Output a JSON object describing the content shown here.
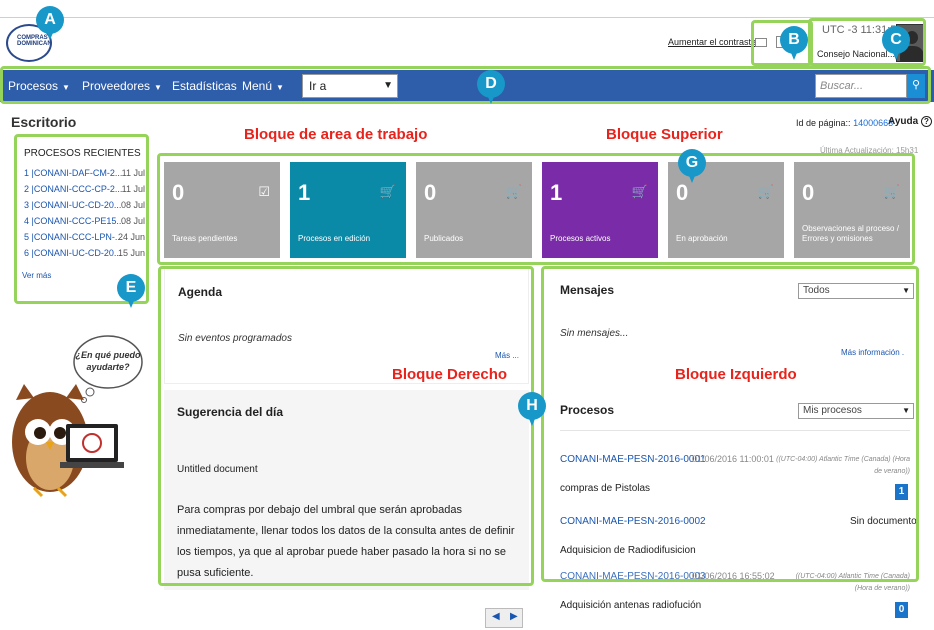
{
  "header": {
    "logo_text": "COMPRAS DOMINICANAS",
    "contrast_link": "Aumentar el contraste",
    "utc": "UTC -3 11:31:5",
    "user": "Consejo Nacional..."
  },
  "nav": {
    "items": [
      "Procesos",
      "Proveedores",
      "Estadísticas",
      "Menú"
    ],
    "goto_value": "Ir a",
    "search_placeholder": "Buscar..."
  },
  "page": {
    "title": "Escritorio",
    "page_id_label": "Id de página::",
    "page_id_value": "14000663",
    "help": "Ayuda",
    "last_update": "Última Actualización: 15h31"
  },
  "annotations": {
    "markers": [
      "A",
      "B",
      "C",
      "D",
      "E",
      "G",
      "H"
    ],
    "labels": {
      "area_trabajo": "Bloque de area de trabajo",
      "superior": "Bloque Superior",
      "derecho": "Bloque Derecho",
      "izquierdo": "Bloque Izquierdo"
    }
  },
  "recent": {
    "title": "PROCESOS RECIENTES",
    "items": [
      {
        "label": "1 |CONANI-DAF-CM-2...",
        "date": "11 Jul"
      },
      {
        "label": "2 |CONANI-CCC-CP-2...",
        "date": "11 Jul"
      },
      {
        "label": "3 |CONANI-UC-CD-20...",
        "date": "08 Jul"
      },
      {
        "label": "4 |CONANI-CCC-PE15...",
        "date": "08 Jul"
      },
      {
        "label": "5 |CONANI-CCC-LPN-...",
        "date": "24 Jun"
      },
      {
        "label": "6 |CONANI-UC-CD-20...",
        "date": "15 Jun"
      }
    ],
    "more": "Ver más"
  },
  "owl": {
    "bubble": "¿En qué puedo ayudarte?"
  },
  "tiles": [
    {
      "count": "0",
      "label": "Tareas pendientes",
      "color": "#a6a6a6"
    },
    {
      "count": "1",
      "label": "Procesos en edición",
      "color": "#0b8aa8"
    },
    {
      "count": "0",
      "label": "Publicados",
      "color": "#a6a6a6"
    },
    {
      "count": "1",
      "label": "Procesos activos",
      "color": "#7a2ba8"
    },
    {
      "count": "0",
      "label": "En aprobación",
      "color": "#a6a6a6"
    },
    {
      "count": "0",
      "label": "Observaciones al proceso / Errores y omisiones",
      "color": "#a6a6a6"
    }
  ],
  "agenda": {
    "title": "Agenda",
    "empty": "Sin eventos programados",
    "more": "Más ..."
  },
  "sugerencia": {
    "title": "Sugerencia del día",
    "subtitle": "Untitled document",
    "body": "Para compras por debajo del umbral que serán aprobadas inmediatamente, llenar todos los datos de la consulta antes de definir los tiempos, ya que al aprobar puede haber pasado la hora si no se pusa suficiente."
  },
  "mensajes": {
    "title": "Mensajes",
    "filter": "Todos",
    "empty": "Sin mensajes...",
    "more": "Más información ."
  },
  "procesos": {
    "title": "Procesos",
    "filter": "Mis procesos",
    "rows": [
      {
        "code": "CONANI-MAE-PESN-2016-0001",
        "date": "01/06/2016 11:00:01",
        "tz": "((UTC-04:00) Atlantic Time (Canada) (Hora de verano))",
        "desc": "compras de Pistolas",
        "badge": "1"
      },
      {
        "code": "CONANI-MAE-PESN-2016-0002",
        "date": "",
        "tz": "",
        "status": "Sin documento",
        "desc": "Adquisicion de Radiodifusicion",
        "badge": ""
      },
      {
        "code": "CONANI-MAE-PESN-2016-0003",
        "date": "01/06/2016 16:55:02",
        "tz": "((UTC-04:00) Atlantic Time (Canada) (Hora de verano))",
        "desc": "Adquisición antenas radiofución",
        "badge": "0"
      }
    ]
  }
}
